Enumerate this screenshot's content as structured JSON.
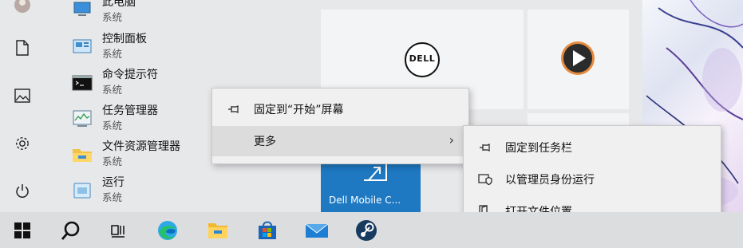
{
  "apps": [
    {
      "name": "此电脑",
      "sub": "系统",
      "icon": "computer-icon"
    },
    {
      "name": "控制面板",
      "sub": "系统",
      "icon": "control-panel-icon"
    },
    {
      "name": "命令提示符",
      "sub": "系统",
      "icon": "command-prompt-icon"
    },
    {
      "name": "任务管理器",
      "sub": "系统",
      "icon": "task-manager-icon"
    },
    {
      "name": "文件资源管理器",
      "sub": "系统",
      "icon": "folder-icon"
    },
    {
      "name": "运行",
      "sub": "系统",
      "icon": "run-icon"
    }
  ],
  "tiles": {
    "dell_logo": "DELL",
    "dell_mobile_label": "Dell Mobile C..."
  },
  "context_menu": {
    "pin_start": "固定到“开始”屏幕",
    "more": "更多",
    "more_arrow": "›"
  },
  "submenu": {
    "pin_taskbar": "固定到任务栏",
    "run_admin": "以管理员身份运行",
    "open_location": "打开文件位置"
  },
  "colors": {
    "tile_blue": "#1e79c2",
    "menu_bg": "#f0f0f0",
    "highlight": "#dcdcdc"
  }
}
